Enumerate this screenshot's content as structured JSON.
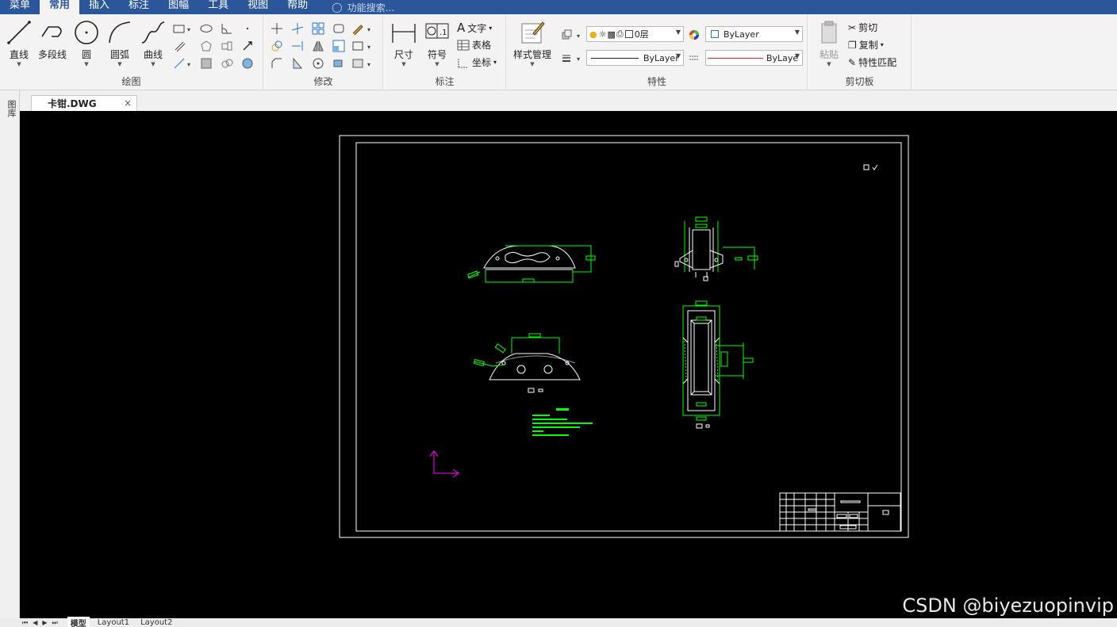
{
  "menubar": {
    "items": [
      "菜单",
      "常用",
      "插入",
      "标注",
      "图幅",
      "工具",
      "视图",
      "帮助"
    ],
    "active_index": 1,
    "search_placeholder": "功能搜索..."
  },
  "ribbon": {
    "draw": {
      "title": "绘图",
      "line": "直线",
      "polyline": "多段线",
      "circle": "圆",
      "arc": "圆弧",
      "curve": "曲线"
    },
    "modify": {
      "title": "修改"
    },
    "annotate": {
      "title": "标注",
      "dimension": "尺寸",
      "symbol": "符号",
      "text": "文字",
      "table": "表格",
      "coordinate": "坐标"
    },
    "properties": {
      "title": "特性",
      "style_manager": "样式管理",
      "layer_value": "0层",
      "color_value": "ByLayer",
      "linetype_value": "ByLayer",
      "lineweight_value": "ByLaye"
    },
    "clipboard": {
      "title": "剪切板",
      "paste": "粘贴",
      "cut": "剪切",
      "copy": "复制",
      "match_properties": "特性匹配"
    }
  },
  "sidebar": {
    "label": "图库"
  },
  "document": {
    "tab_title": "卡钳.DWG",
    "close_glyph": "×"
  },
  "canvas": {
    "background": "#000000",
    "frame_color": "#ffffff",
    "geometry_color": "#ffffff",
    "dimension_color": "#00ff00",
    "ucs_color": "#ff00ff"
  },
  "watermark": "CSDN @biyezuopinvip",
  "layout_tabs": {
    "nav": "⏮◀▶⏭",
    "items": [
      "模型",
      "Layout1",
      "Layout2"
    ],
    "active_index": 0
  }
}
